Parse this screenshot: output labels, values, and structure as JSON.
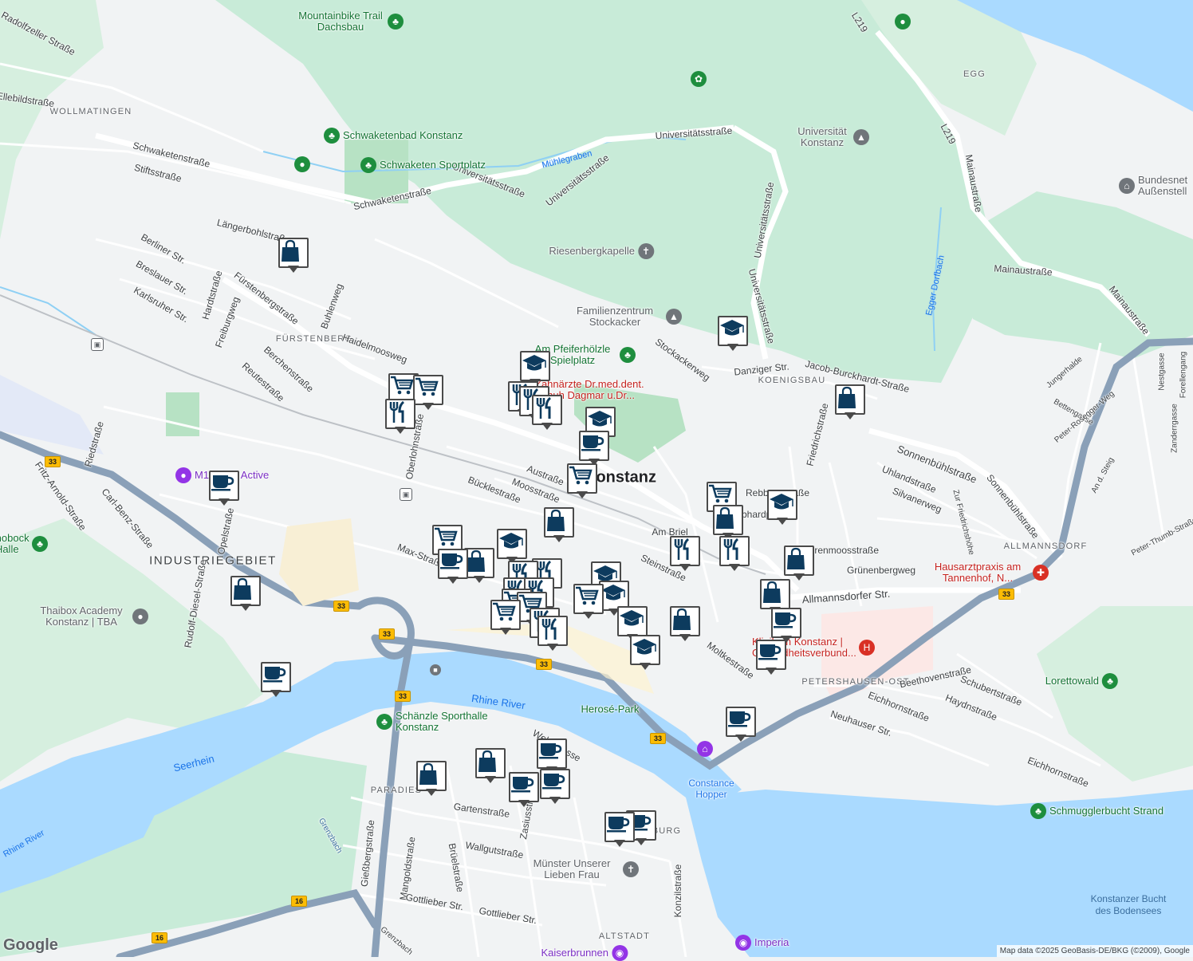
{
  "map_labels": {
    "city": "Konstanz",
    "districts": [
      "WOLLMATINGEN",
      "FÜRSTENBERG",
      "INDUSTRIEGEBIET",
      "KOENIGSBAU",
      "ALLMANNSDORF",
      "PETERSHAUSEN-OST",
      "PARADIES",
      "ALTSTADT",
      "EGG",
      "BURG"
    ],
    "streets": [
      "Radolfzeller Straße",
      "Stiftsstraße",
      "Schwaketenstraße",
      "Schwaketenstraße",
      "Universitätsstraße",
      "Universitätsstraße",
      "Universitätsstraße",
      "Universitätsstraße",
      "Universitätsstraße",
      "Längerbohlstraße",
      "Berliner Str.",
      "Breslauer Str.",
      "Karlsruher Str.",
      "Hardtstraße",
      "Freiburgweg",
      "Fürstenbergstraße",
      "Buhlenweg",
      "Haidelmoosweg",
      "Berchenstraße",
      "Reutestraße",
      "Riedstraße",
      "Fritz-Arnold-Straße",
      "Carl-Benz-Straße",
      "Opelstraße",
      "Rudolf-Diesel-Straße",
      "Oberlohnstraße",
      "Austraße",
      "Moosstraße",
      "Bücklestraße",
      "Max-Straße",
      "Am Briel",
      "Steinstraße",
      "Rebbergstraße",
      "Gebhardplatz",
      "Sierenmoosstraße",
      "Grünenbergweg",
      "Allmannsdorfer Str.",
      "Moltkestraße",
      "Beethovenstraße",
      "Schubertstraße",
      "Haydnstraße",
      "Eichhornstraße",
      "Eichhornstraße",
      "Neuhauser Str.",
      "Jacob-Burckhardt-Straße",
      "Danziger Str.",
      "Stockackerweg",
      "Friedrichstraße",
      "Uhlandstraße",
      "Silvanerweg",
      "Sonnenbühlstraße",
      "Sonnenbühlstraße",
      "Mainaustraße",
      "Mainaustraße",
      "Mainaustraße",
      "L219",
      "L219",
      "Jungerhalde",
      "Bettengasse",
      "Peter-Rosegger-Weg",
      "An d. Steig",
      "Nestgasse",
      "Zanderrgasse",
      "Peter-Thumb-Straße",
      "Forellengang",
      "Webergasse",
      "Gartenstraße",
      "Wallgutstraße",
      "Zasiusstraße",
      "Mangoldstraße",
      "Gießbergstraße",
      "Brüelstraße",
      "Gottlieber Str.",
      "Gottlieber Str.",
      "Konzilstraße",
      "Ellebildstraße",
      "Zur Friedrichshöhe",
      "Grenzbach",
      "Grenzbach"
    ],
    "water": [
      "Rhine River",
      "Seerhein",
      "Rhine River",
      "Mühlegraben",
      "Egger Dorfbach",
      "Konstanzer Bucht des Bodensees"
    ],
    "road_shields": [
      "33",
      "33",
      "33",
      "33",
      "33",
      "33",
      "33",
      "16",
      "16",
      "L219"
    ],
    "poi": [
      {
        "name": "Mountainbike Trail Dachsbau",
        "icon": "park-icon",
        "style": "park"
      },
      {
        "name": "Schwaketenbad Konstanz",
        "icon": "park-icon",
        "style": "park"
      },
      {
        "name": "Schwaketen Sportplatz",
        "icon": "park-icon",
        "style": "park"
      },
      {
        "name": "Universität Konstanz",
        "icon": "school-icon",
        "style": "gray"
      },
      {
        "name": "Riesenbergkapelle",
        "icon": "church-icon",
        "style": "gray"
      },
      {
        "name": "Familienzentrum Stockacker",
        "icon": "school-icon",
        "style": "gray"
      },
      {
        "name": "Am Pfeiferhölzle Spielplatz",
        "icon": "park-icon",
        "style": "park"
      },
      {
        "name": "Zahnärzte Dr.med.dent. Schuh Dagmar u.Dr...",
        "icon": "hospital-icon",
        "style": "red"
      },
      {
        "name": "M10 True Active",
        "icon": "gym-icon",
        "style": "purple"
      },
      {
        "name": "Thaibox Academy Konstanz | TBA",
        "icon": "place-icon",
        "style": "gray"
      },
      {
        "name": "Schänzle Sporthalle Konstanz",
        "icon": "park-icon",
        "style": "park"
      },
      {
        "name": "Herosé-Park",
        "icon": "",
        "style": "park"
      },
      {
        "name": "Constance Hopper",
        "icon": "",
        "style": "transit-text"
      },
      {
        "name": "Münster Unserer Lieben Frau",
        "icon": "church-icon",
        "style": "gray"
      },
      {
        "name": "Imperia",
        "icon": "camera-icon",
        "style": "purple"
      },
      {
        "name": "Kaiserbrunnen",
        "icon": "camera-icon",
        "style": "purple"
      },
      {
        "name": "Klinikum Konstanz | Gesundheitsverbund...",
        "icon": "hospital-icon",
        "style": "red"
      },
      {
        "name": "Hausarztpraxis am Tannenhof, N...",
        "icon": "hospital-icon",
        "style": "red"
      },
      {
        "name": "Lorettowald",
        "icon": "park-icon",
        "style": "park"
      },
      {
        "name": "Schmugglerbucht Strand",
        "icon": "park-icon",
        "style": "park"
      },
      {
        "name": "Bundesnet Außenstell",
        "icon": "government-icon",
        "style": "gray"
      },
      {
        "name": "Knobock - Halle",
        "icon": "park-icon",
        "style": "park"
      }
    ]
  },
  "markers": [
    {
      "type": "shopping-bag",
      "label": "Shopping"
    },
    {
      "type": "cart",
      "label": "Supermarket"
    },
    {
      "type": "cart",
      "label": "Supermarket"
    },
    {
      "type": "restaurant",
      "label": "Restaurant"
    },
    {
      "type": "school",
      "label": "School"
    },
    {
      "type": "restaurant",
      "label": "Restaurant"
    },
    {
      "type": "restaurant",
      "label": "Restaurant"
    },
    {
      "type": "restaurant",
      "label": "Restaurant"
    },
    {
      "type": "school",
      "label": "School"
    },
    {
      "type": "cafe",
      "label": "Cafe"
    },
    {
      "type": "cart",
      "label": "Supermarket"
    },
    {
      "type": "school",
      "label": "School"
    },
    {
      "type": "shopping-bag",
      "label": "Shopping"
    },
    {
      "type": "cart",
      "label": "Supermarket"
    },
    {
      "type": "shopping-bag",
      "label": "Shopping"
    },
    {
      "type": "school",
      "label": "School"
    },
    {
      "type": "shopping-bag",
      "label": "Shopping"
    },
    {
      "type": "cafe",
      "label": "Cafe"
    },
    {
      "type": "cart",
      "label": "Supermarket"
    },
    {
      "type": "cafe",
      "label": "Cafe"
    },
    {
      "type": "shopping-bag",
      "label": "Shopping"
    },
    {
      "type": "school",
      "label": "School"
    },
    {
      "type": "restaurant",
      "label": "Restaurant"
    },
    {
      "type": "restaurant",
      "label": "Restaurant"
    },
    {
      "type": "restaurant",
      "label": "Restaurant"
    },
    {
      "type": "restaurant",
      "label": "Restaurant"
    },
    {
      "type": "cart",
      "label": "Supermarket"
    },
    {
      "type": "cart",
      "label": "Supermarket"
    },
    {
      "type": "cart",
      "label": "Supermarket"
    },
    {
      "type": "restaurant",
      "label": "Restaurant"
    },
    {
      "type": "restaurant",
      "label": "Restaurant"
    },
    {
      "type": "school",
      "label": "School"
    },
    {
      "type": "cart",
      "label": "Supermarket"
    },
    {
      "type": "school",
      "label": "School"
    },
    {
      "type": "school",
      "label": "School"
    },
    {
      "type": "shopping-bag",
      "label": "Shopping"
    },
    {
      "type": "school",
      "label": "School"
    },
    {
      "type": "restaurant",
      "label": "Restaurant"
    },
    {
      "type": "restaurant",
      "label": "Restaurant"
    },
    {
      "type": "shopping-bag",
      "label": "Shopping"
    },
    {
      "type": "shopping-bag",
      "label": "Shopping"
    },
    {
      "type": "cafe",
      "label": "Cafe"
    },
    {
      "type": "cafe",
      "label": "Cafe"
    },
    {
      "type": "shopping-bag",
      "label": "Shopping"
    },
    {
      "type": "cafe",
      "label": "Cafe"
    },
    {
      "type": "cafe",
      "label": "Cafe"
    },
    {
      "type": "shopping-bag",
      "label": "Shopping"
    },
    {
      "type": "shopping-bag",
      "label": "Shopping"
    },
    {
      "type": "cafe",
      "label": "Cafe"
    },
    {
      "type": "cafe",
      "label": "Cafe"
    },
    {
      "type": "cafe",
      "label": "Cafe"
    },
    {
      "type": "cafe",
      "label": "Cafe"
    },
    {
      "type": "cafe",
      "label": "Cafe"
    }
  ],
  "footer": {
    "logo": "Google",
    "attribution": "Map data ©2025 GeoBasis-DE/BKG (©2009), Google"
  },
  "colors": {
    "water": "#aadaff",
    "park": "#c8ebd8",
    "land": "#f1f3f4",
    "road": "#ffffff",
    "highway": "#8aa0b8",
    "marker_icon": "#0d3b5e"
  }
}
